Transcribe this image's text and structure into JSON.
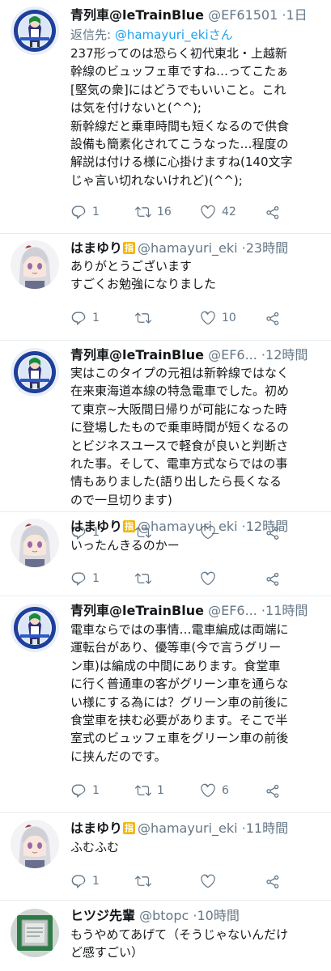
{
  "tweets": [
    {
      "name": "青列車@leTrainBlue",
      "handle": "@EF61501",
      "dot": "·",
      "time": "1日",
      "reply_prefix": "返信先: ",
      "reply_target": "@hamayuri_ekiさん",
      "body": "237形ってのは恐らく初代東北・上越新\n幹線のビュッフェ車ですね…ってこたぁ\n[堅気の衆]にはどうでもいいこと。これ\nは気を付けないと(^^);\n新幹線だと乗車時間も短くなるので供食\n設備も簡素化されてこうなった…程度の\n解説は付ける様に心掛けますね(140文字\nじゃ言い切れないけれど)(^^);",
      "replies": "1",
      "retweets": "16",
      "likes": "42"
    },
    {
      "name": "はまゆり",
      "badge": "指",
      "handle": "@hamayuri_eki",
      "dot": "·",
      "time": "23時間",
      "body": "ありがとうございます\nすごくお勉強になりました",
      "replies": "1",
      "retweets": "",
      "likes": "10"
    },
    {
      "name": "青列車@leTrainBlue",
      "handle": "@EF6...",
      "dot": "·",
      "time": "12時間",
      "body": "実はこのタイプの元祖は新幹線ではなく\n在来東海道本線の特急電車でした。初め\nて東京~大阪間日帰りが可能になった時\nに登場したもので乗車時間が短くなるの\nとビジネスユースで軽食が良いと判断さ\nれた事。そして、電車方式ならではの事\n情もありました(語り出したら長くなる\nので一旦切ります)",
      "replies": "1",
      "retweets": "",
      "likes": ""
    },
    {
      "name": "はまゆり",
      "badge": "指",
      "handle": "@hamayuri_eki",
      "dot": "·",
      "time": "12時間",
      "body": "いったんきるのかー",
      "replies": "1",
      "retweets": "",
      "likes": ""
    },
    {
      "name": "青列車@leTrainBlue",
      "handle": "@EF6...",
      "dot": "·",
      "time": "11時間",
      "body": "電車ならではの事情…電車編成は両端に\n運転台があり、優等車(今で言うグリー\nン車)は編成の中間にあります。食堂車\nに行く普通車の客がグリーン車を通らな\nい様にする為には？グリーン車の前後に\n食堂車を挟む必要があります。そこで半\n室式のビュッフェ車をグリーン車の前後\nに挟んだのです。",
      "replies": "1",
      "retweets": "1",
      "likes": "6"
    },
    {
      "name": "はまゆり",
      "badge": "指",
      "handle": "@hamayuri_eki",
      "dot": "·",
      "time": "11時間",
      "body": "ふむふむ",
      "replies": "1",
      "retweets": "",
      "likes": ""
    },
    {
      "name": "ヒツジ先輩",
      "handle": "@btopc",
      "dot": "·",
      "time": "10時間",
      "body": "もうやめてあげて（そうじゃないんだけ\nど感すごい）"
    }
  ],
  "icons": {
    "reply": "reply-icon",
    "retweet": "retweet-icon",
    "like": "heart-icon",
    "share": "share-icon"
  },
  "colors": {
    "link": "#1da1f2",
    "secondary_text": "#657786",
    "badge": "#f2b705",
    "divider": "#e6ecf0"
  }
}
